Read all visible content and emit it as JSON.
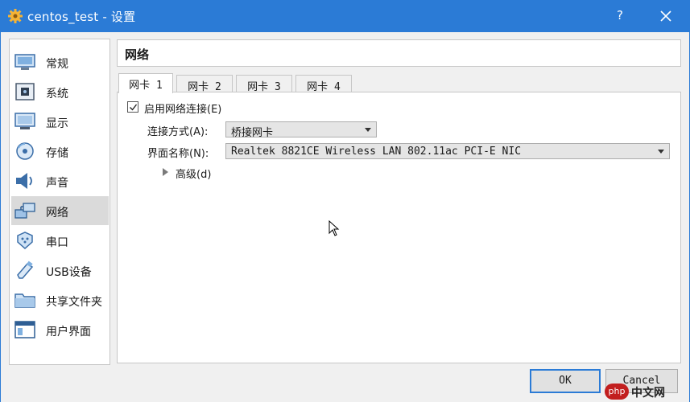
{
  "window": {
    "title": "centos_test - 设置",
    "help": "?",
    "accent": "#2b7bd6",
    "close_icon": "close-icon",
    "app_icon": "gear-icon"
  },
  "sidebar": {
    "items": [
      {
        "label": "常规",
        "icon": "general-icon",
        "selected": false
      },
      {
        "label": "系统",
        "icon": "motherboard-icon",
        "selected": false
      },
      {
        "label": "显示",
        "icon": "monitor-icon",
        "selected": false
      },
      {
        "label": "存储",
        "icon": "storage-icon",
        "selected": false
      },
      {
        "label": "声音",
        "icon": "speaker-icon",
        "selected": false
      },
      {
        "label": "网络",
        "icon": "network-icon",
        "selected": true
      },
      {
        "label": "串口",
        "icon": "serial-port-icon",
        "selected": false
      },
      {
        "label": "USB设备",
        "icon": "usb-icon",
        "selected": false
      },
      {
        "label": "共享文件夹",
        "icon": "folder-icon",
        "selected": false
      },
      {
        "label": "用户界面",
        "icon": "ui-icon",
        "selected": false
      }
    ]
  },
  "header": {
    "title": "网络"
  },
  "tabs": [
    {
      "label": "网卡 1",
      "active": true
    },
    {
      "label": "网卡 2",
      "active": false
    },
    {
      "label": "网卡 3",
      "active": false
    },
    {
      "label": "网卡 4",
      "active": false
    }
  ],
  "adapter": {
    "enable_label": "启用网络连接(E)",
    "enabled": true,
    "attached_label": "连接方式(A):",
    "attached_value": "桥接网卡",
    "name_label": "界面名称(N):",
    "name_value": "Realtek 8821CE Wireless LAN 802.11ac PCI-E NIC",
    "advanced_label": "高级(d)"
  },
  "buttons": {
    "ok": "OK",
    "cancel": "Cancel"
  },
  "watermark": {
    "logo": "php",
    "text": "中文网"
  }
}
